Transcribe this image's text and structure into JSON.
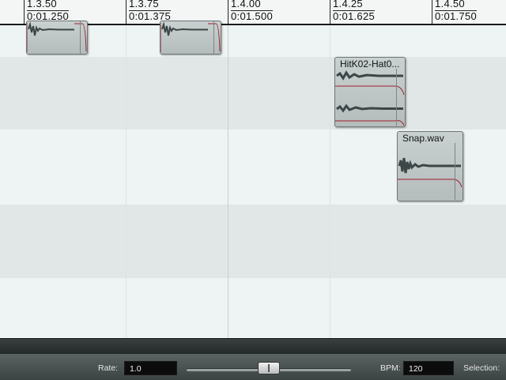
{
  "ruler": {
    "marks": [
      {
        "beat": "1.3.50",
        "time": "0:01.250"
      },
      {
        "beat": "1.3.75",
        "time": "0:01.375"
      },
      {
        "beat": "1.4.00",
        "time": "0:01.500"
      },
      {
        "beat": "1.4.25",
        "time": "0:01.625"
      },
      {
        "beat": "1.4.50",
        "time": "0:01.750"
      }
    ]
  },
  "items": {
    "hitk": {
      "title": "HitK02-Hat0..."
    },
    "snap": {
      "title": "Snap.wav"
    }
  },
  "transport": {
    "rate_label": "Rate:",
    "rate_value": "1.0",
    "bpm_label": "BPM:",
    "bpm_value": "120",
    "selection_label": "Selection:"
  },
  "colors": {
    "item_fill": "#bfc7c7",
    "fade_line": "#a0202a",
    "lane_light": "#eef3f3",
    "lane_dark": "#e1e6e6"
  }
}
